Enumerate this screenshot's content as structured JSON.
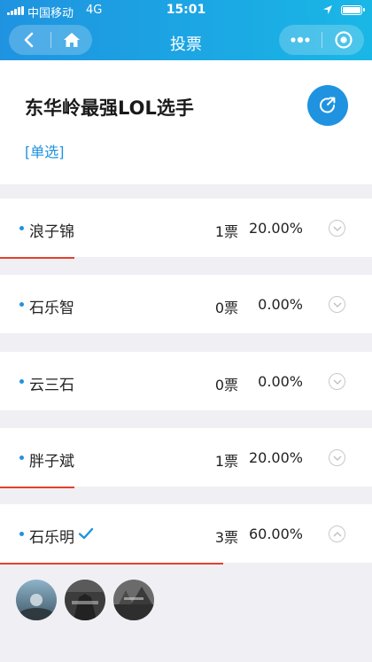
{
  "status_bar": {
    "carrier": "中国移动",
    "network": "4G",
    "time": "15:01"
  },
  "nav": {
    "title": "投票"
  },
  "poll": {
    "title": "东华岭最强LOL选手",
    "type_label": "[单选]"
  },
  "options": [
    {
      "name": "浪子锦",
      "votes": "1票",
      "percent": "20.00%",
      "share": 0.2,
      "selected": false,
      "expanded": false
    },
    {
      "name": "石乐智",
      "votes": "0票",
      "percent": "0.00%",
      "share": 0.0,
      "selected": false,
      "expanded": false
    },
    {
      "name": "云三石",
      "votes": "0票",
      "percent": "0.00%",
      "share": 0.0,
      "selected": false,
      "expanded": false
    },
    {
      "name": "胖子斌",
      "votes": "1票",
      "percent": "20.00%",
      "share": 0.2,
      "selected": false,
      "expanded": false
    },
    {
      "name": "石乐明",
      "votes": "3票",
      "percent": "60.00%",
      "share": 0.6,
      "selected": true,
      "expanded": true
    }
  ],
  "voters": {
    "avatar_count": 3
  },
  "colors": {
    "header_start": "#1f93e0",
    "header_end": "#19b7e6",
    "accent": "#1f93e0",
    "progress": "#e6402b"
  }
}
